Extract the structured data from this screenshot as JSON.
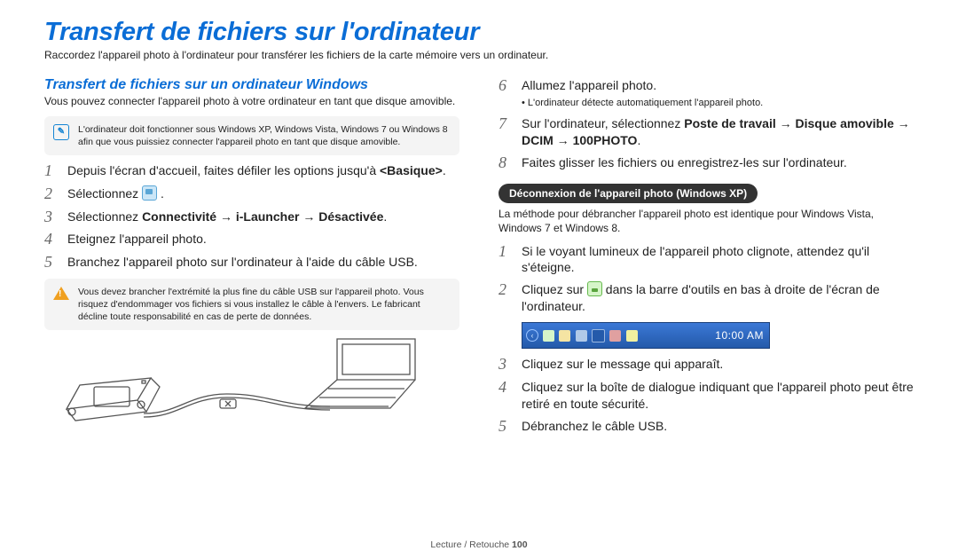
{
  "title": "Transfert de fichiers sur l'ordinateur",
  "intro": "Raccordez l'appareil photo à l'ordinateur pour transférer les fichiers de la carte mémoire vers un ordinateur.",
  "left": {
    "subtitle": "Transfert de fichiers sur un ordinateur Windows",
    "desc": "Vous pouvez connecter l'appareil photo à votre ordinateur en tant que disque amovible.",
    "note": "L'ordinateur doit fonctionner sous Windows XP, Windows Vista, Windows 7 ou Windows 8 afin que vous puissiez connecter l'appareil photo en tant que disque amovible.",
    "steps": {
      "s1_a": "Depuis l'écran d'accueil, faites défiler les options jusqu'à ",
      "s1_b": "<Basique>",
      "s1_c": ".",
      "s2_a": "Sélectionnez ",
      "s2_b": " .",
      "s3_a": "Sélectionnez ",
      "s3_b": "Connectivité",
      "s3_c": " → ",
      "s3_d": "i-Launcher",
      "s3_e": " → ",
      "s3_f": "Désactivée",
      "s3_g": ".",
      "s4": "Eteignez l'appareil photo.",
      "s5": "Branchez l'appareil photo sur l'ordinateur à l'aide du câble USB."
    },
    "warn": "Vous devez brancher l'extrémité la plus fine du câble USB sur l'appareil photo. Vous risquez d'endommager vos fichiers si vous installez le câble à l'envers. Le fabricant décline toute responsabilité en cas de perte de données."
  },
  "right": {
    "steps_a": {
      "s6": "Allumez l'appareil photo.",
      "s6_sub": "L'ordinateur détecte automatiquement l'appareil photo.",
      "s7_a": "Sur l'ordinateur, sélectionnez ",
      "s7_b": "Poste de travail",
      "s7_c": " → ",
      "s7_d": "Disque amovible",
      "s7_e": " → ",
      "s7_f": "DCIM",
      "s7_g": " → ",
      "s7_h": "100PHOTO",
      "s7_i": ".",
      "s8": "Faites glisser les fichiers ou enregistrez-les sur l'ordinateur."
    },
    "badge": "Déconnexion de l'appareil photo (Windows XP)",
    "badge_desc": "La méthode pour débrancher l'appareil photo est identique pour Windows Vista, Windows 7 et Windows 8.",
    "steps_b": {
      "s1": "Si le voyant lumineux de l'appareil photo clignote, attendez qu'il s'éteigne.",
      "s2_a": "Cliquez sur ",
      "s2_b": " dans la barre d'outils en bas à droite de l'écran de l'ordinateur.",
      "s3": "Cliquez sur le message qui apparaît.",
      "s4": "Cliquez sur la boîte de dialogue indiquant que l'appareil photo peut être retiré en toute sécurité.",
      "s5": "Débranchez le câble USB."
    },
    "taskbar_time": "10:00 AM"
  },
  "numbers": {
    "n1": "1",
    "n2": "2",
    "n3": "3",
    "n4": "4",
    "n5": "5",
    "n6": "6",
    "n7": "7",
    "n8": "8"
  },
  "footer": {
    "section": "Lecture / Retouche  ",
    "page": "100"
  },
  "bullet": "• "
}
